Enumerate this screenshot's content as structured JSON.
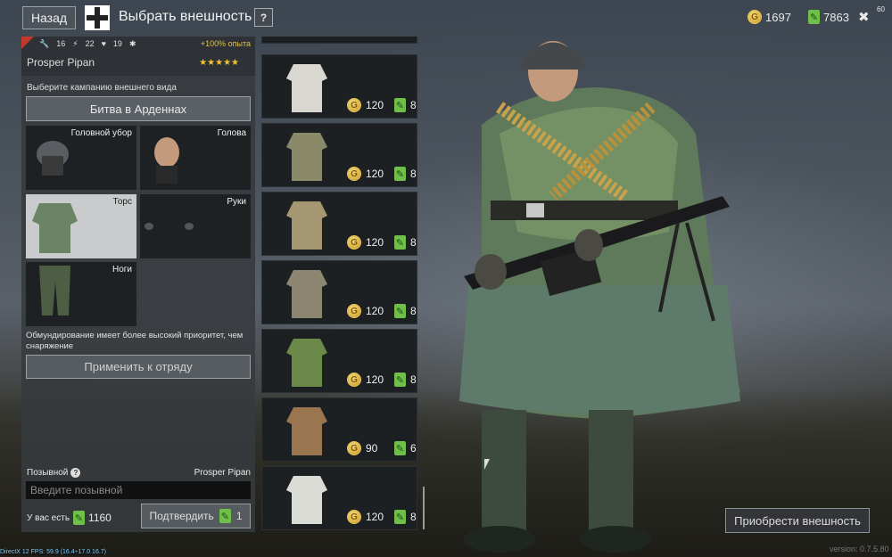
{
  "topbar": {
    "back_label": "Назад",
    "title": "Выбрать внешность",
    "help_label": "?",
    "gold": "1697",
    "silver": "7863",
    "close_label": "✖",
    "fps_small": "60"
  },
  "soldier": {
    "stat1": "16",
    "stat2": "22",
    "stat3": "19",
    "exp_bonus": "+100% опыта",
    "name": "Prosper Pipan",
    "stars": "★★★★★"
  },
  "campaign": {
    "label": "Выберите кампанию внешнего вида",
    "selected": "Битва в Арденнах"
  },
  "slots": {
    "headgear": "Головной убор",
    "head": "Голова",
    "torso": "Торс",
    "hands": "Руки",
    "legs": "Ноги"
  },
  "priority_note": "Обмундирование имеет более высокий приоритет, чем снаряжение",
  "apply_label": "Применить к отряду",
  "callsign": {
    "label": "Позывной",
    "name": "Prosper Pipan",
    "placeholder": "Введите позывной"
  },
  "balance": {
    "label": "У вас есть",
    "value": "1160"
  },
  "confirm": {
    "label": "Подтвердить",
    "cost": "1"
  },
  "items": [
    {
      "gold": "120",
      "leaf": "8",
      "color": "#d8d8d0"
    },
    {
      "gold": "120",
      "leaf": "8",
      "color": "#8a8a6a"
    },
    {
      "gold": "120",
      "leaf": "8",
      "color": "#a39670"
    },
    {
      "gold": "120",
      "leaf": "8",
      "color": "#8c8670"
    },
    {
      "gold": "120",
      "leaf": "8",
      "color": "#6b8a4a"
    },
    {
      "gold": "90",
      "leaf": "6",
      "color": "#9a7650"
    },
    {
      "gold": "120",
      "leaf": "8",
      "color": "#dcdcd6"
    }
  ],
  "purchase_label": "Приобрести внешность",
  "debug_text": "DirectX 12 FPS: 59.9 (16.4÷17.0 16.7)",
  "version_text": "version: 0.7.5.80"
}
